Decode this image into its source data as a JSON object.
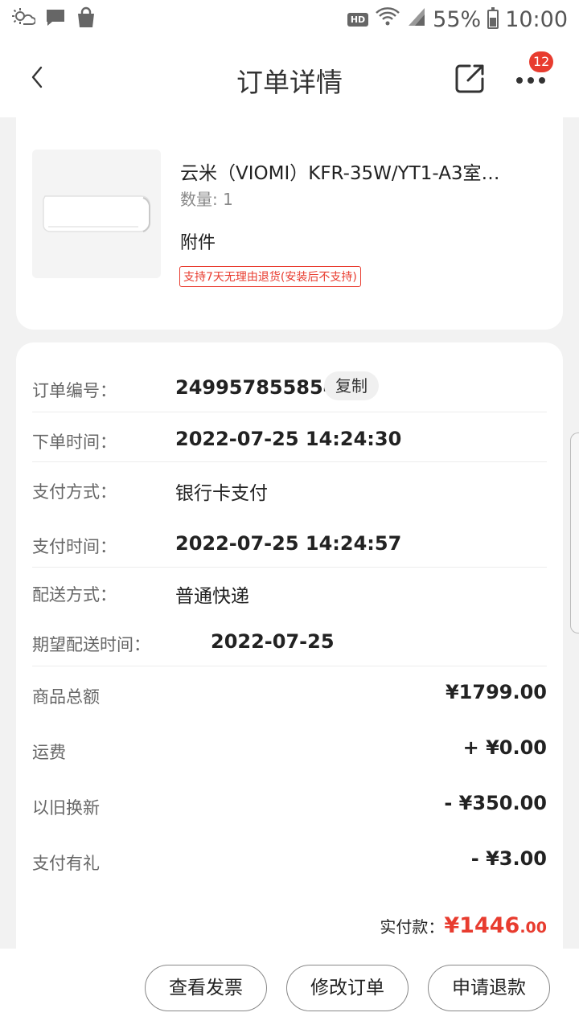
{
  "status_bar": {
    "icons": [
      "weather-icon",
      "message-icon",
      "shopping-bag-icon",
      "hd-icon",
      "wifi-icon",
      "signal-icon",
      "battery-icon"
    ],
    "hd": "HD",
    "battery": "55%",
    "battery_level": 0.55,
    "time": "10:00"
  },
  "nav": {
    "title": "订单详情",
    "badge": "12"
  },
  "product": {
    "name": "云米（VIOMI）KFR-35W/YT1-A3室…",
    "quantity": "数量: 1",
    "accessory": "附件",
    "return_tag": "支持7天无理由退货(安装后不支持)"
  },
  "order": {
    "number_label": "订单编号：",
    "number": "249957855854",
    "copy_label": "复制",
    "placed_label": "下单时间：",
    "placed_time": "2022-07-25 14:24:30",
    "pay_method_label": "支付方式：",
    "pay_method": "银行卡支付",
    "pay_time_label": "支付时间：",
    "pay_time": "2022-07-25 14:24:57",
    "delivery_label": "配送方式：",
    "delivery": "普通快递",
    "expected_label": "期望配送时间：",
    "expected_date": "2022-07-25"
  },
  "amounts": {
    "goods_label": "商品总额",
    "goods_value": "¥1799.00",
    "shipping_label": "运费",
    "shipping_value": "+ ¥0.00",
    "tradein_label": "以旧换新",
    "tradein_value": "- ¥350.00",
    "gift_label": "支付有礼",
    "gift_value": "- ¥3.00",
    "paid_label": "实付款：",
    "paid_int": "¥1446",
    "paid_dec": ".00"
  },
  "actions": {
    "invoice": "查看发票",
    "modify": "修改订单",
    "refund": "申请退款"
  },
  "colors": {
    "accent": "#e83c2f",
    "background": "#f2f2f2"
  }
}
